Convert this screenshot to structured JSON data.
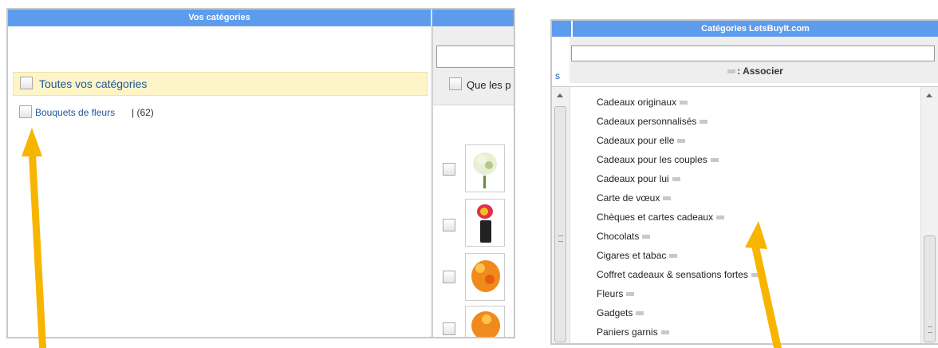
{
  "left_panel": {
    "header": "Vos catégories",
    "all_categories_label": "Toutes vos catégories",
    "category_label": "Bouquets de fleurs",
    "category_sep": " | ",
    "category_count": "(62)"
  },
  "middle_panel": {
    "filter_label": "Que les p"
  },
  "right_panel": {
    "header": "Catégories LetsBuyIt.com",
    "side_letter": "s",
    "associate_label": ": Associer",
    "items": [
      "Cadeaux originaux",
      "Cadeaux personnalisés",
      "Cadeaux pour elle",
      "Cadeaux pour les couples",
      "Cadeaux pour lui",
      "Carte de vœux",
      "Chèques et cartes cadeaux",
      "Chocolats",
      "Cigares et tabac",
      "Coffret cadeaux & sensations fortes",
      "Fleurs",
      "Gadgets",
      "Paniers garnis"
    ]
  },
  "colors": {
    "header_blue": "#5d9cec",
    "highlight_row": "#fdf4c8",
    "link_blue": "#1e5799",
    "arrow_yellow": "#f7b500"
  }
}
